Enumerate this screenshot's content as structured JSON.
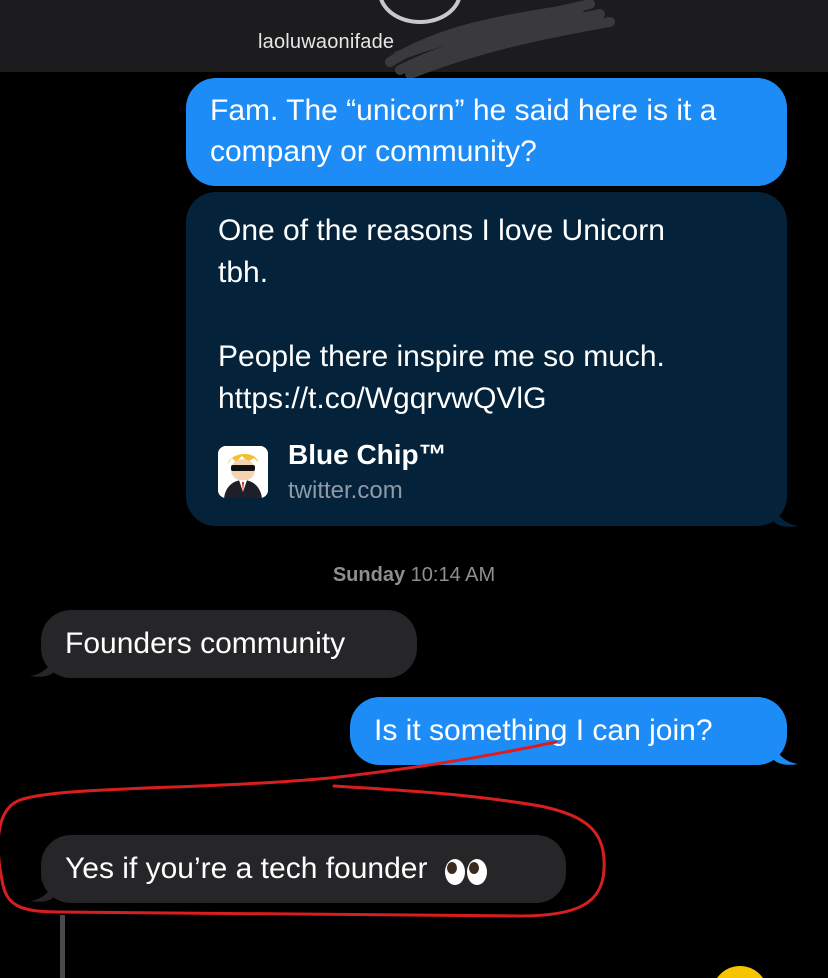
{
  "header": {
    "contact_name": "laoluwaonifade"
  },
  "messages": [
    {
      "direction": "outgoing",
      "text": "Fam. The “unicorn” he said here is it a company or community?"
    },
    {
      "direction": "outgoing",
      "type": "link",
      "lines": [
        "One of the reasons I love Unicorn",
        "tbh.",
        "",
        "People there inspire me so much.",
        "https://t.co/WgqrvwQVlG"
      ],
      "preview": {
        "title": "Blue Chip™",
        "domain": "twitter.com"
      }
    },
    {
      "direction": "incoming",
      "text": "Founders community"
    },
    {
      "direction": "outgoing",
      "text": "Is it something I can join?"
    },
    {
      "direction": "incoming",
      "text": "Yes if you’re a tech founder",
      "emoji": "eyes"
    }
  ],
  "timestamp": {
    "day": "Sunday",
    "time": "10:14 AM"
  },
  "colors": {
    "outgoing_bubble": "#1e8cf7",
    "incoming_bubble": "#262629",
    "link_card": "#04233a",
    "annotation": "#d81e1e"
  }
}
